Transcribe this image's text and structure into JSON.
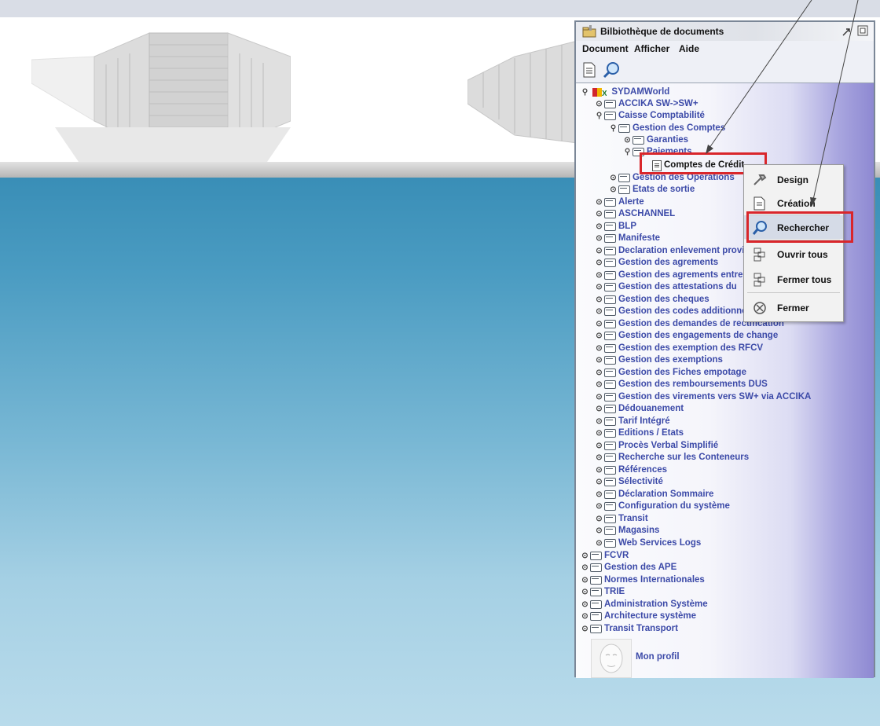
{
  "window": {
    "title": "Bilbiothèque de documents"
  },
  "menu": [
    "Document",
    "Afficher",
    "Aide"
  ],
  "tree": [
    {
      "label": "SYDAMWorld",
      "expanded": true
    },
    {
      "label": "ACCIKA SW->SW+"
    },
    {
      "label": "Caisse Comptabilité",
      "expanded": true
    },
    {
      "label": "Gestion des Comptes",
      "expanded": true
    },
    {
      "label": "Garanties"
    },
    {
      "label": "Paiements",
      "expanded": true
    },
    {
      "label": "Comptes de Crédit",
      "selected": true
    },
    {
      "label": "Gestion des Opérations"
    },
    {
      "label": "Etats de sortie"
    },
    {
      "label": "Alerte"
    },
    {
      "label": "ASCHANNEL"
    },
    {
      "label": "BLP"
    },
    {
      "label": "Manifeste"
    },
    {
      "label": "Declaration enlevement provisoire"
    },
    {
      "label": "Gestion des agrements"
    },
    {
      "label": "Gestion des agrements entrepots"
    },
    {
      "label": "Gestion des attestations du"
    },
    {
      "label": "Gestion des cheques"
    },
    {
      "label": "Gestion des codes additionnels"
    },
    {
      "label": "Gestion des demandes de rectification"
    },
    {
      "label": "Gestion des engagements de change"
    },
    {
      "label": "Gestion des exemption des RFCV"
    },
    {
      "label": "Gestion des exemptions"
    },
    {
      "label": "Gestion des Fiches empotage"
    },
    {
      "label": "Gestion des remboursements DUS"
    },
    {
      "label": "Gestion des virements vers SW+ via ACCIKA"
    },
    {
      "label": "Dédouanement"
    },
    {
      "label": "Tarif Intégré"
    },
    {
      "label": "Editions / Etats"
    },
    {
      "label": "Procès Verbal Simplifié"
    },
    {
      "label": "Recherche sur les Conteneurs"
    },
    {
      "label": "Références"
    },
    {
      "label": "Sélectivité"
    },
    {
      "label": "Déclaration Sommaire"
    },
    {
      "label": "Configuration du système"
    },
    {
      "label": "Transit"
    },
    {
      "label": "Magasins"
    },
    {
      "label": "Web Services Logs"
    },
    {
      "label": "FCVR"
    },
    {
      "label": "Gestion des APE"
    },
    {
      "label": "Normes Internationales"
    },
    {
      "label": "TRIE"
    },
    {
      "label": "Administration Système"
    },
    {
      "label": "Architecture système"
    },
    {
      "label": "Transit Transport"
    }
  ],
  "profile": {
    "label": "Mon profil"
  },
  "context_menu": [
    {
      "label": "Design",
      "icon": "wrench-icon"
    },
    {
      "label": "Création",
      "icon": "new-document-icon"
    },
    {
      "label": "Rechercher",
      "icon": "magnifier-icon",
      "highlighted": true
    },
    {
      "label": "Ouvrir tous",
      "icon": "expand-all-icon"
    },
    {
      "label": "Fermer tous",
      "icon": "collapse-all-icon"
    },
    {
      "label": "Fermer",
      "icon": "close-circle-icon"
    }
  ]
}
